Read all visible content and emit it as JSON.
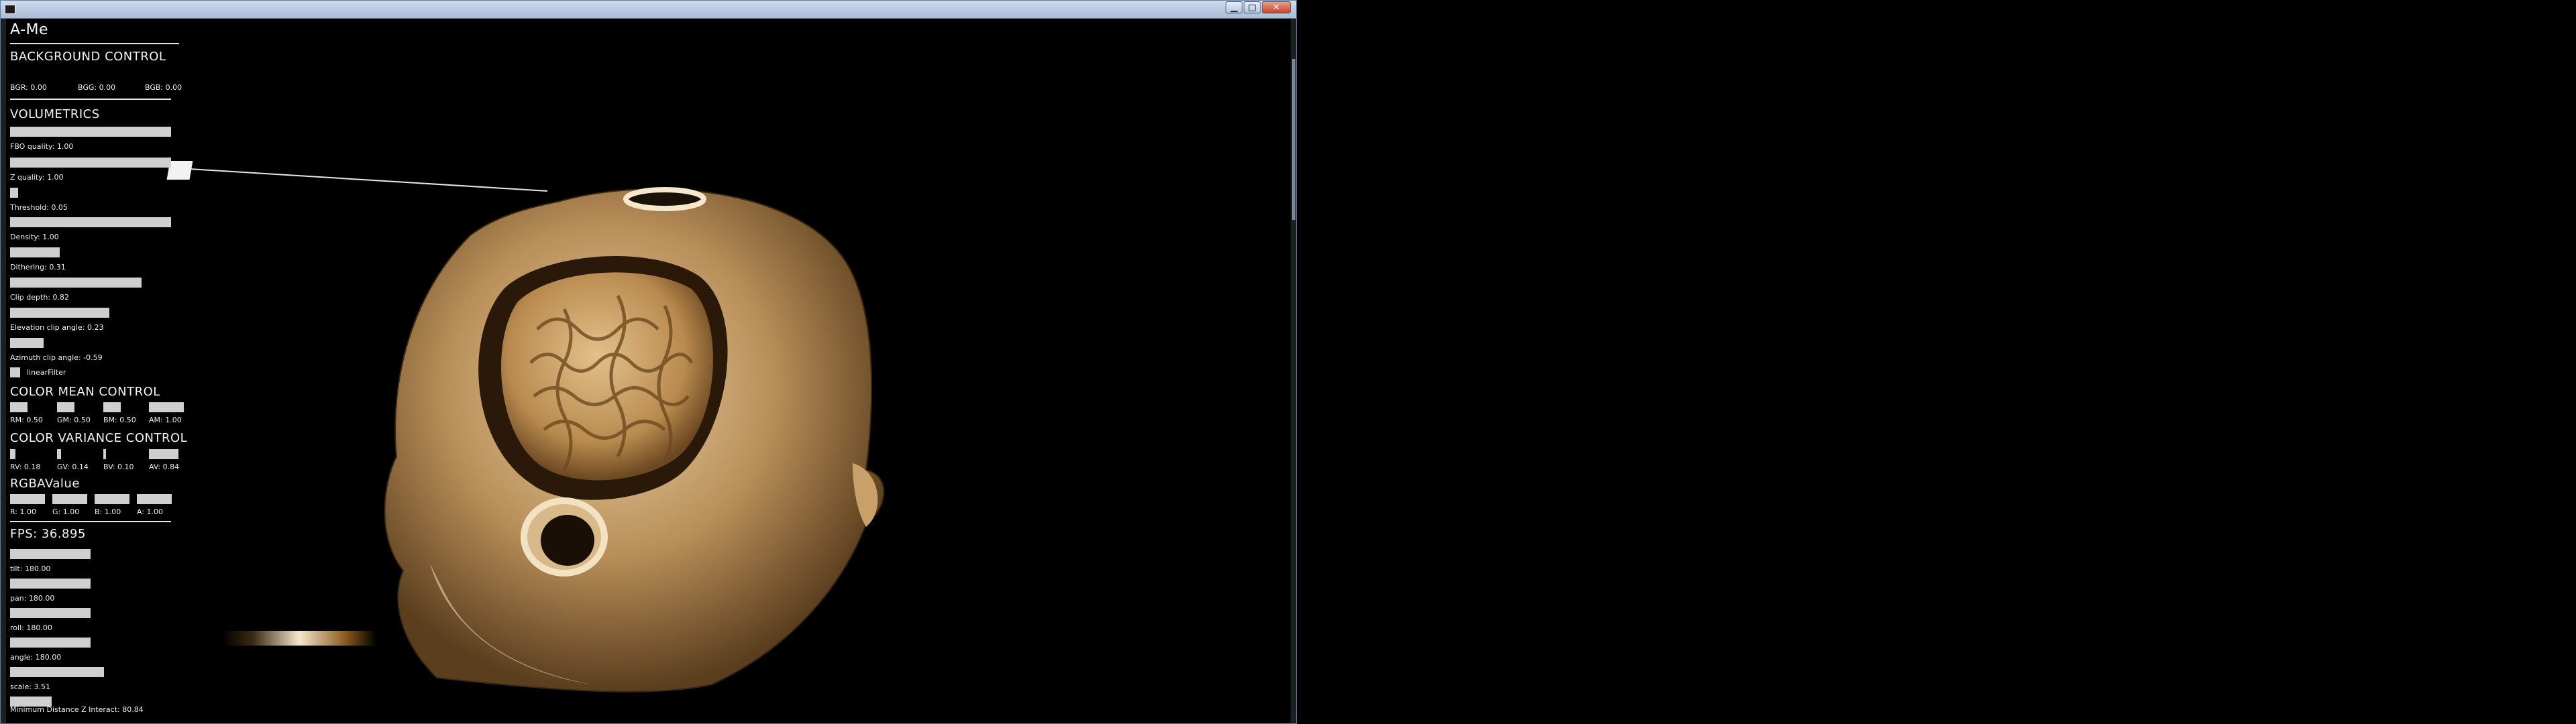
{
  "app": {
    "title": "A-Me"
  },
  "background": {
    "header": "BACKGROUND CONTROL",
    "bgr": "BGR: 0.00",
    "bgg": "BGG: 0.00",
    "bgb": "BGB: 0.00"
  },
  "volumetrics": {
    "header": "VOLUMETRICS",
    "sliders": [
      {
        "label": "FBO quality: 1.00",
        "value": 1.0
      },
      {
        "label": "Z quality: 1.00",
        "value": 1.0
      },
      {
        "label": "Threshold: 0.05",
        "value": 0.05
      },
      {
        "label": "Density: 1.00",
        "value": 1.0
      },
      {
        "label": "Dithering: 0.31",
        "value": 0.31
      },
      {
        "label": "Clip depth: 0.82",
        "value": 0.82
      },
      {
        "label": "Elevation clip angle: 0.23",
        "value": 0.62
      },
      {
        "label": "Azimuth clip angle: -0.59",
        "value": 0.21
      }
    ],
    "linear_filter": "linearFilter"
  },
  "color_mean": {
    "header": "COLOR MEAN CONTROL",
    "items": [
      {
        "label": "RM: 0.50",
        "value": 0.5
      },
      {
        "label": "GM: 0.50",
        "value": 0.5
      },
      {
        "label": "BM: 0.50",
        "value": 0.5
      },
      {
        "label": "AM: 1.00",
        "value": 1.0
      }
    ]
  },
  "color_variance": {
    "header": "COLOR VARIANCE CONTROL",
    "items": [
      {
        "label": "RV: 0.18",
        "value": 0.18
      },
      {
        "label": "GV: 0.14",
        "value": 0.14
      },
      {
        "label": "BV: 0.10",
        "value": 0.1
      },
      {
        "label": "AV: 0.84",
        "value": 0.84
      }
    ]
  },
  "rgba": {
    "header": "RGBAValue",
    "items": [
      {
        "label": "R: 1.00",
        "value": 1.0
      },
      {
        "label": "G: 1.00",
        "value": 1.0
      },
      {
        "label": "B: 1.00",
        "value": 1.0
      },
      {
        "label": "A: 1.00",
        "value": 1.0
      }
    ]
  },
  "fps": "FPS: 36.895",
  "camera": {
    "sliders": [
      {
        "label": "tilt: 180.00",
        "value": 1.0
      },
      {
        "label": "pan: 180.00",
        "value": 1.0
      },
      {
        "label": "roll: 180.00",
        "value": 1.0
      },
      {
        "label": "angle: 180.00",
        "value": 1.0
      },
      {
        "label": "scale: 3.51",
        "value": 1.0
      },
      {
        "label": "Minimum Distance Z Interact: 80.84",
        "value": 1.0
      }
    ]
  },
  "colors": {
    "slider_fill": "#cfcfcf",
    "text": "#f0f0f0",
    "bone": "#d9b88a"
  },
  "window_buttons": {
    "minimize": "minimize-icon",
    "maximize": "maximize-icon",
    "close": "close-icon"
  }
}
